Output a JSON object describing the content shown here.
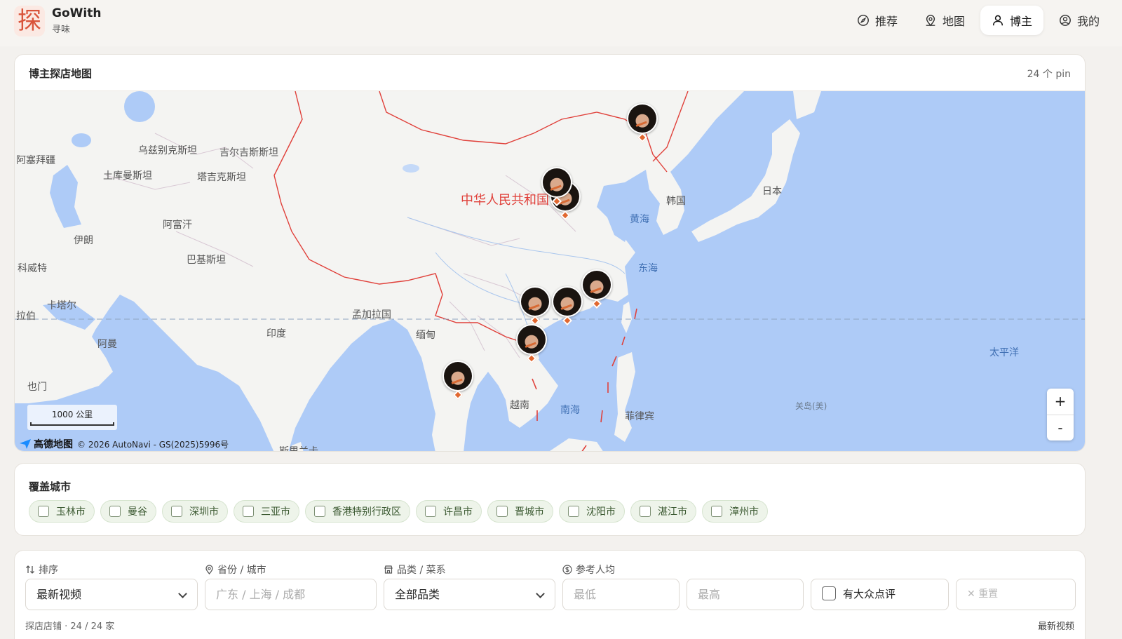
{
  "app": {
    "logo_char": "探",
    "title": "GoWith",
    "subtitle": "寻味"
  },
  "nav": [
    {
      "label": "推荐",
      "icon": "compass-icon",
      "active": false
    },
    {
      "label": "地图",
      "icon": "map-pin-icon",
      "active": false
    },
    {
      "label": "博主",
      "icon": "user-icon",
      "active": true
    },
    {
      "label": "我的",
      "icon": "user-circle-icon",
      "active": false
    }
  ],
  "map_card": {
    "title": "博主探店地图",
    "pin_count": "24 个 pin",
    "labels": {
      "azerbaijan": "阿塞拜疆",
      "uzbekistan": "乌兹别克斯坦",
      "kyrgyzstan": "吉尔吉斯斯坦",
      "turkmenistan": "土库曼斯坦",
      "tajikistan": "塔吉克斯坦",
      "afghanistan": "阿富汗",
      "iran": "伊朗",
      "pakistan": "巴基斯坦",
      "kuwait": "科威特",
      "qatar": "卡塔尔",
      "arabia": "拉伯",
      "oman": "阿曼",
      "yemen": "也门",
      "india": "印度",
      "bangladesh": "孟加拉国",
      "myanmar": "缅甸",
      "vietnam": "越南",
      "philippines": "菲律宾",
      "china": "中华人民共和国",
      "korea": "韩国",
      "japan": "日本",
      "yellow_sea": "黄海",
      "east_sea": "东海",
      "south_sea": "南海",
      "pacific": "太平洋",
      "guam": "关岛(美)",
      "srilanka": "斯里兰卡"
    },
    "scale_label": "1000 公里",
    "attribution_logo": "高德地图",
    "attribution_text": "© 2026 AutoNavi - GS(2025)5996号",
    "zoom_in": "+",
    "zoom_out": "-"
  },
  "cities": {
    "title": "覆盖城市",
    "items": [
      "玉林市",
      "曼谷",
      "深圳市",
      "三亚市",
      "香港特别行政区",
      "许昌市",
      "晋城市",
      "沈阳市",
      "湛江市",
      "漳州市"
    ]
  },
  "filters": {
    "sort_label": "排序",
    "sort_value": "最新视频",
    "city_label": "省份 / 城市",
    "city_placeholder": "广东 / 上海 / 成都",
    "category_label": "品类 / 菜系",
    "category_value": "全部品类",
    "price_label": "参考人均",
    "price_min_placeholder": "最低",
    "price_max_placeholder": "最高",
    "dianping_label": "有大众点评",
    "reset_label": "重置",
    "result_text": "探店店铺 · 24 / 24 家",
    "sort_hint": "最新视频"
  },
  "colors": {
    "accent": "#d9533a",
    "sea": "#aecbf7",
    "land": "#f4f4f2",
    "chip_bg": "#eef4ea",
    "pin_tip": "#e1672f"
  }
}
